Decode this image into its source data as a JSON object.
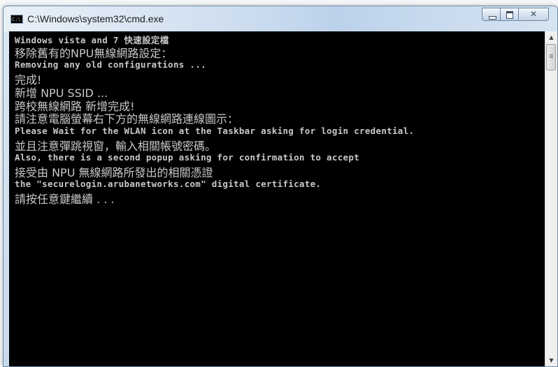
{
  "window": {
    "title": "C:\\Windows\\system32\\cmd.exe",
    "icon": "cmd-icon",
    "icon_text": "C:\\",
    "buttons": {
      "minimize": "minimize-icon",
      "maximize": "maximize-icon",
      "close_glyph": "✕"
    }
  },
  "console": {
    "lines": [
      "Windows vista and 7 快速設定檔",
      "移除舊有的NPU無線網路設定：",
      "Removing any old configurations ...",
      "完成!",
      "新增  NPU SSID ...",
      "跨校無線網路     新增完成!",
      "請注意電腦螢幕右下方的無線網路連線圖示：",
      "Please Wait for the WLAN icon at the Taskbar asking for login credential.",
      "並且注意彈跳視窗，輸入相關帳號密碼。",
      "Also, there is a second popup asking for confirmation to accept",
      "接受由 NPU 無線網路所發出的相關憑證",
      "the \"securelogin.arubanetworks.com\" digital certificate.",
      "請按任意鍵繼續 . . ."
    ]
  },
  "scrollbar": {
    "up_glyph": "▲",
    "down_glyph": "▼"
  },
  "colors": {
    "console_bg": "#000000",
    "console_text": "#c8c8c8"
  }
}
